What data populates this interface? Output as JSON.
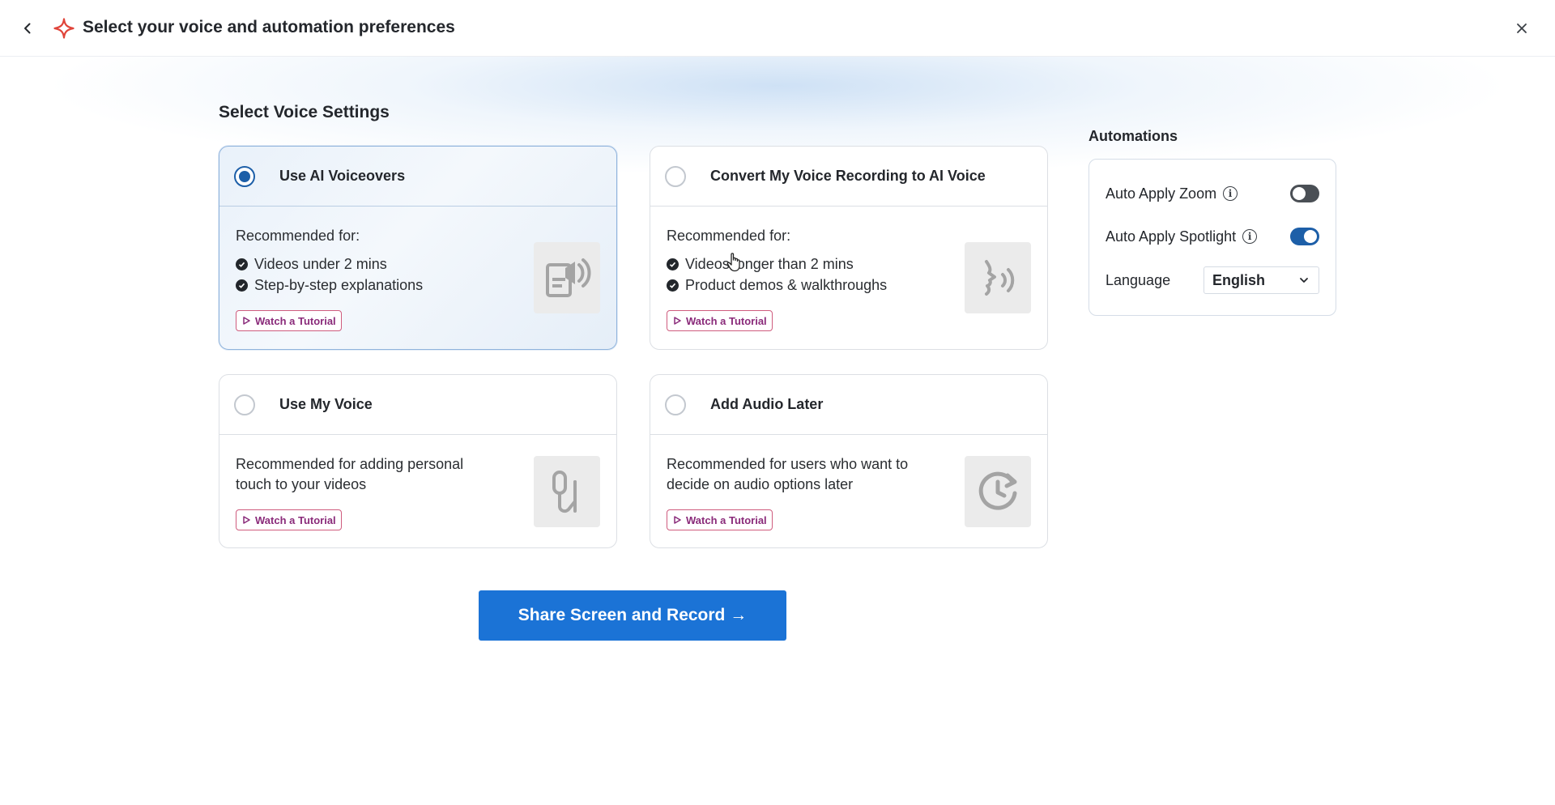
{
  "header": {
    "title": "Select your voice and automation preferences"
  },
  "voice": {
    "section_title": "Select Voice Settings",
    "cards": [
      {
        "title": "Use AI Voiceovers",
        "selected": true,
        "recommended_label": "Recommended for:",
        "bullets": [
          "Videos under 2 mins",
          "Step-by-step explanations"
        ],
        "tutorial": "Watch a Tutorial",
        "icon": "ai-voiceover-icon"
      },
      {
        "title": "Convert My Voice Recording to AI Voice",
        "selected": false,
        "recommended_label": "Recommended for:",
        "bullets": [
          "Videos longer than 2 mins",
          "Product demos & walkthroughs"
        ],
        "tutorial": "Watch a Tutorial",
        "icon": "speaking-head-icon"
      },
      {
        "title": "Use My Voice",
        "selected": false,
        "recommended_text": "Recommended for adding personal touch to your videos",
        "tutorial": "Watch a Tutorial",
        "icon": "microphone-icon"
      },
      {
        "title": "Add Audio Later",
        "selected": false,
        "recommended_text": "Recommended for users who want to decide on audio options later",
        "tutorial": "Watch a Tutorial",
        "icon": "clock-later-icon"
      }
    ],
    "cta": "Share Screen and Record →"
  },
  "automations": {
    "title": "Automations",
    "zoom_label": "Auto Apply Zoom",
    "zoom_on": false,
    "spotlight_label": "Auto Apply Spotlight",
    "spotlight_on": true,
    "language_label": "Language",
    "language_value": "English"
  },
  "colors": {
    "accent": "#1b73d6",
    "radio_selected": "#1d5fa8",
    "tutorial_border": "#cf5c7e",
    "tutorial_text": "#8a2b7a",
    "sparkle": "#e0443a"
  }
}
